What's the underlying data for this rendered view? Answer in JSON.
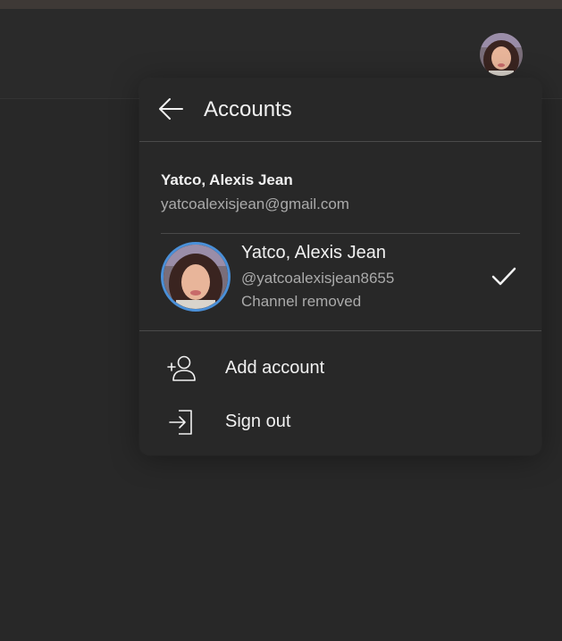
{
  "header": {
    "avatar_icon": "user-avatar-photo"
  },
  "popup": {
    "title": "Accounts",
    "back_icon": "arrow-left-icon",
    "google_account": {
      "name": "Yatco, Alexis Jean",
      "email": "yatcoalexisjean@gmail.com"
    },
    "channel": {
      "name": "Yatco, Alexis Jean",
      "handle": "@yatcoalexisjean8655",
      "status": "Channel removed",
      "selected": true,
      "accent_color": "#4a90d9"
    },
    "menu": [
      {
        "label": "Add account",
        "icon": "add-person-icon"
      },
      {
        "label": "Sign out",
        "icon": "sign-out-icon"
      }
    ]
  },
  "colors": {
    "background": "#282828",
    "text_primary": "#f1f1f1",
    "text_secondary": "#aaaaaa",
    "divider": "#4a4a4a"
  }
}
